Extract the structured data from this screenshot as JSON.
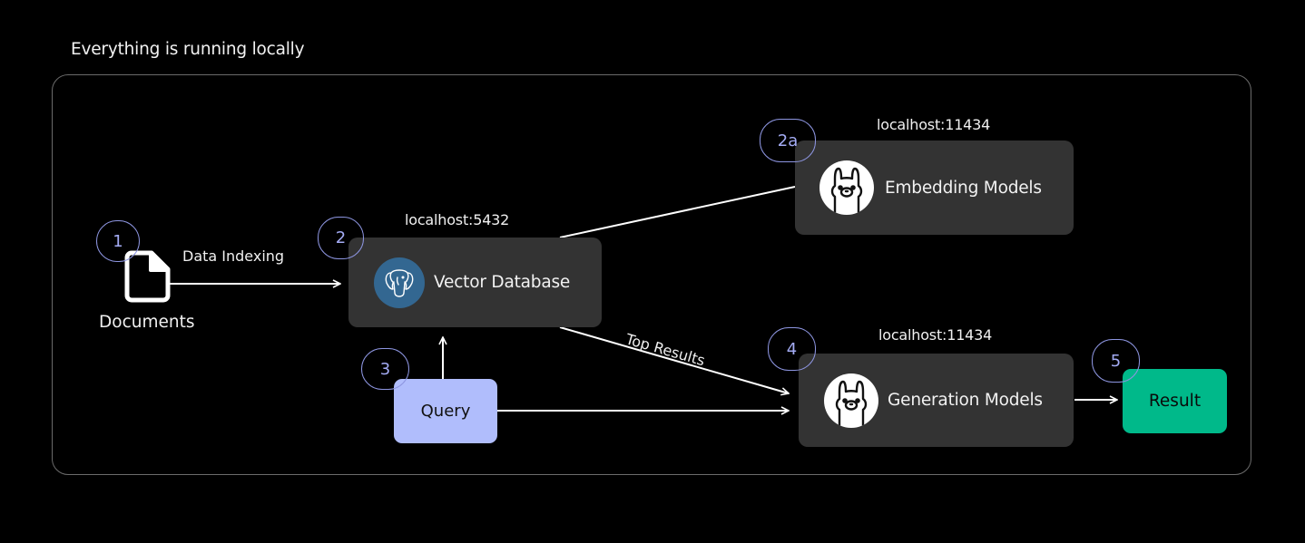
{
  "caption": "Everything is running locally",
  "documents": {
    "label": "Documents",
    "icon": "document-icon"
  },
  "edges": {
    "data_indexing": "Data Indexing",
    "top_results": "Top Results"
  },
  "vector_db": {
    "label": "Vector Database",
    "host": "localhost:5432",
    "icon": "postgresql-elephant-icon",
    "color": "#336791"
  },
  "embedding": {
    "label": "Embedding Models",
    "host": "localhost:11434",
    "icon": "ollama-llama-icon"
  },
  "generation": {
    "label": "Generation Models",
    "host": "localhost:11434",
    "icon": "ollama-llama-icon"
  },
  "query": {
    "label": "Query",
    "color": "#b0bdfc"
  },
  "result": {
    "label": "Result",
    "color": "#00b98a"
  },
  "steps": [
    "1",
    "2",
    "2a",
    "3",
    "4",
    "5"
  ]
}
